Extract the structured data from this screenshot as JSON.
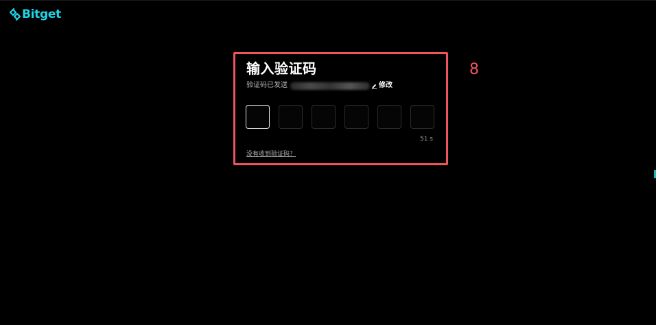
{
  "brand": {
    "name": "Bitget",
    "icon": "bitget-logo-icon",
    "color": "#1fd6e8"
  },
  "verification": {
    "title": "输入验证码",
    "sent_label": "验证码已发送",
    "edit_label": "修改",
    "edit_icon": "pencil-icon",
    "code_length": 6,
    "timer": "51 s",
    "no_code_link": "没有收到验证码？"
  },
  "annotation": {
    "number": "8",
    "color": "#f0545c"
  }
}
